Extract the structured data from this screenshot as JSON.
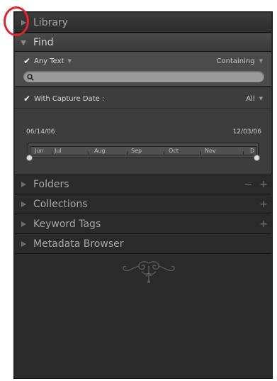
{
  "panel": {
    "library": {
      "label": "Library"
    },
    "find": {
      "label": "Find",
      "text_filter": {
        "checked": true,
        "label": "Any Text",
        "match": "Containing",
        "search_value": ""
      },
      "date_filter": {
        "checked": true,
        "label": "With Capture Date :",
        "scope": "All",
        "start_date": "06/14/06",
        "end_date": "12/03/06",
        "months": [
          "Jun",
          "Jul",
          "Aug",
          "Sep",
          "Oct",
          "Nov",
          "D"
        ]
      }
    },
    "folders": {
      "label": "Folders",
      "minus": "−",
      "plus": "+"
    },
    "collections": {
      "label": "Collections",
      "plus": "+"
    },
    "keyword_tags": {
      "label": "Keyword Tags",
      "plus": "+"
    },
    "metadata_browser": {
      "label": "Metadata Browser"
    }
  },
  "colors": {
    "panel_bg": "#2a2a2a",
    "header_text": "#a7a7a7",
    "find_body_bg": "#4b4b4b",
    "search_field_bg": "#9b9b9b",
    "highlight_ring": "#e2232f"
  },
  "icons": {
    "collapsed": "triangle-right-icon",
    "expanded": "triangle-down-icon",
    "search": "search-icon",
    "checkbox": "checkmark-icon",
    "dropdown": "caret-down-icon",
    "ornament": "scroll-ornament-icon"
  }
}
